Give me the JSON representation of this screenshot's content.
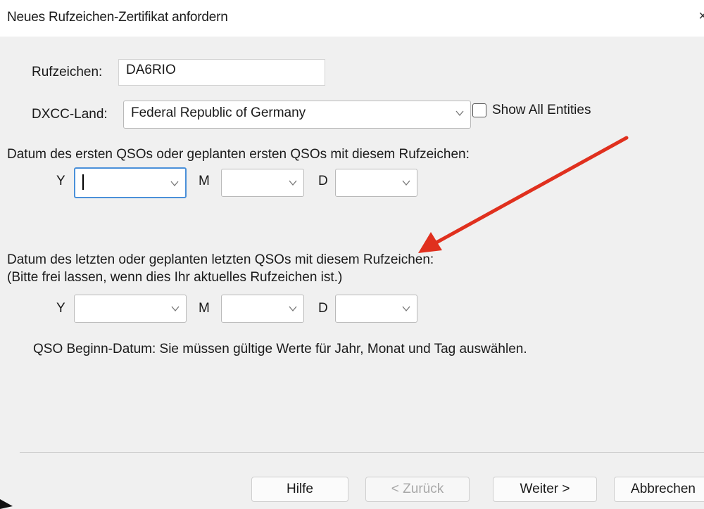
{
  "window": {
    "title": "Neues Rufzeichen-Zertifikat anfordern",
    "close_glyph": "×"
  },
  "form": {
    "callsign_label": "Rufzeichen:",
    "callsign_value": "DA6RIO",
    "dxcc_label": "DXCC-Land:",
    "dxcc_value": "Federal Republic of Germany",
    "show_all_label": "Show All Entities",
    "show_all_checked": false,
    "first_qso_label": "Datum des ersten QSOs oder geplanten ersten QSOs mit diesem Rufzeichen:",
    "last_qso_label": "Datum des letzten oder geplanten letzten QSOs mit diesem Rufzeichen:",
    "last_qso_hint": "(Bitte frei lassen, wenn dies Ihr aktuelles Rufzeichen ist.)",
    "year_label": "Y",
    "month_label": "M",
    "day_label": "D",
    "first_date": {
      "year": "",
      "month": "",
      "day": ""
    },
    "last_date": {
      "year": "",
      "month": "",
      "day": ""
    },
    "validation_message": "QSO Beginn-Datum: Sie müssen gültige Werte für Jahr, Monat und Tag auswählen."
  },
  "buttons": {
    "help": "Hilfe",
    "back": "< Zurück",
    "next": "Weiter >",
    "cancel": "Abbrechen"
  },
  "colors": {
    "annotation_arrow": "#e0301e",
    "focus_border": "#4a90d9"
  }
}
